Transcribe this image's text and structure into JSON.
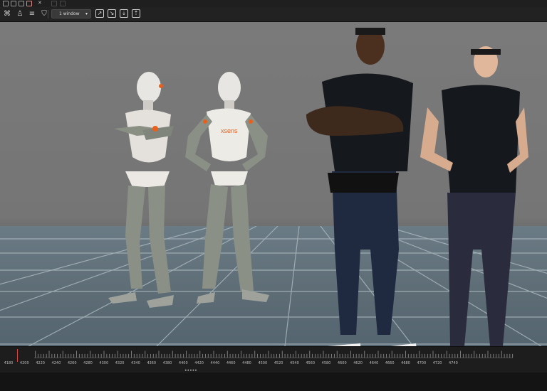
{
  "toolbar": {
    "window_select": "1 window"
  },
  "timeline": {
    "tick_labels": [
      "4180",
      "4200",
      "4220",
      "4240",
      "4260",
      "4280",
      "4300",
      "4320",
      "4340",
      "4360",
      "4380",
      "4400",
      "4420",
      "4440",
      "4460",
      "4480",
      "4500",
      "4520",
      "4540",
      "4560",
      "4580",
      "4600",
      "4620",
      "4640",
      "4660",
      "4680",
      "4700",
      "4720",
      "4740"
    ],
    "dots": "•••••"
  },
  "viewport": {
    "suit_logo": "xsens"
  },
  "colors": {
    "accent_orange": "#e8601c",
    "playhead": "#d8483e",
    "floor": "#5f6e77"
  }
}
